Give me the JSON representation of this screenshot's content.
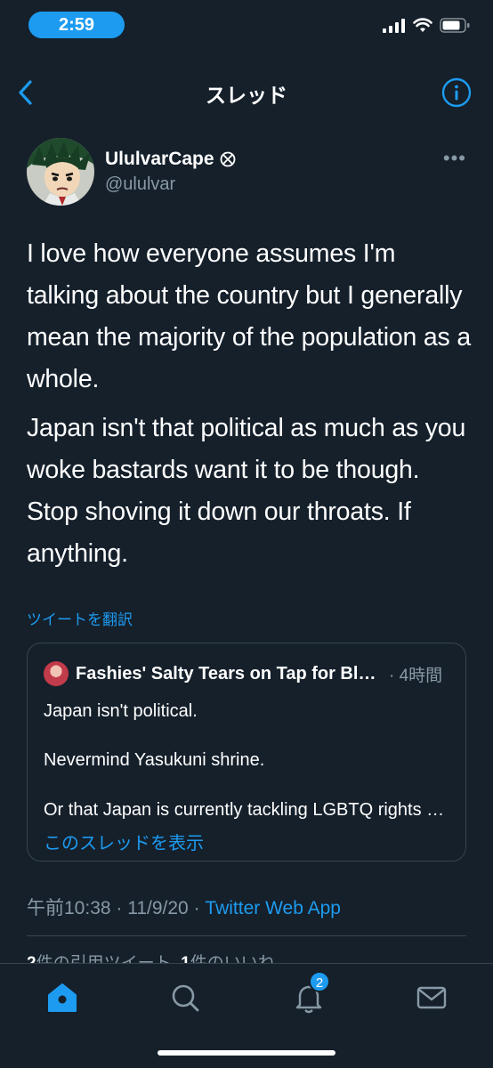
{
  "status_bar": {
    "time": "2:59"
  },
  "header": {
    "title": "スレッド"
  },
  "tweet": {
    "display_name": "UlulvarCape",
    "handle": "@ululvar",
    "paragraphs": [
      "I love how everyone assumes I'm talking about the country but I generally mean the majority of the population as a whole.",
      "Japan isn't that political as much as you woke bastards want it to be though. Stop shoving it down our throats. If anything."
    ],
    "translate_label": "ツイートを翻訳",
    "more_label": "•••"
  },
  "quote": {
    "name": "Fashies' Salty Tears on Tap for Bloodthirsty Leftists",
    "time": "· 4時間",
    "lines": [
      "Japan isn't political.",
      "Nevermind Yasukuni shrine.",
      "Or that Japan is currently tackling LGBTQ rights and racial issues."
    ],
    "show_thread": "このスレッドを表示"
  },
  "meta": {
    "time": "午前10:38",
    "date": "11/9/20",
    "separator": " · ",
    "source": "Twitter Web App"
  },
  "engagement_peek": {
    "quote_count": "2",
    "quote_label": "件の引用ツイート",
    "like_count": "1",
    "like_label": "件のいいね"
  },
  "tab_bar": {
    "notification_badge": "2"
  },
  "colors": {
    "background": "#15202b",
    "accent": "#1d9bf0",
    "secondary_text": "#8899a6",
    "border": "#38444d"
  }
}
